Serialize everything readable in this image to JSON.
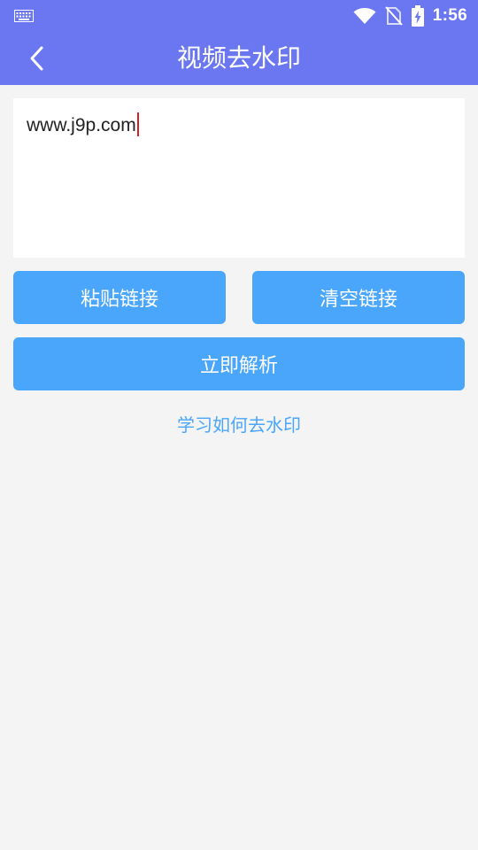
{
  "status_bar": {
    "time": "1:56",
    "icons": [
      "keyboard-icon",
      "wifi-icon",
      "no-sim-icon",
      "battery-charging-icon"
    ]
  },
  "app_bar": {
    "title": "视频去水印",
    "back_icon": "chevron-left-icon"
  },
  "link_input": {
    "value": "www.j9p.com"
  },
  "buttons": {
    "paste_label": "粘贴链接",
    "clear_label": "清空链接",
    "parse_label": "立即解析"
  },
  "learn_link": {
    "label": "学习如何去水印"
  },
  "colors": {
    "header": "#6b77f1",
    "button": "#4aa6fb",
    "background": "#f4f4f4",
    "caret": "#d81e27"
  }
}
